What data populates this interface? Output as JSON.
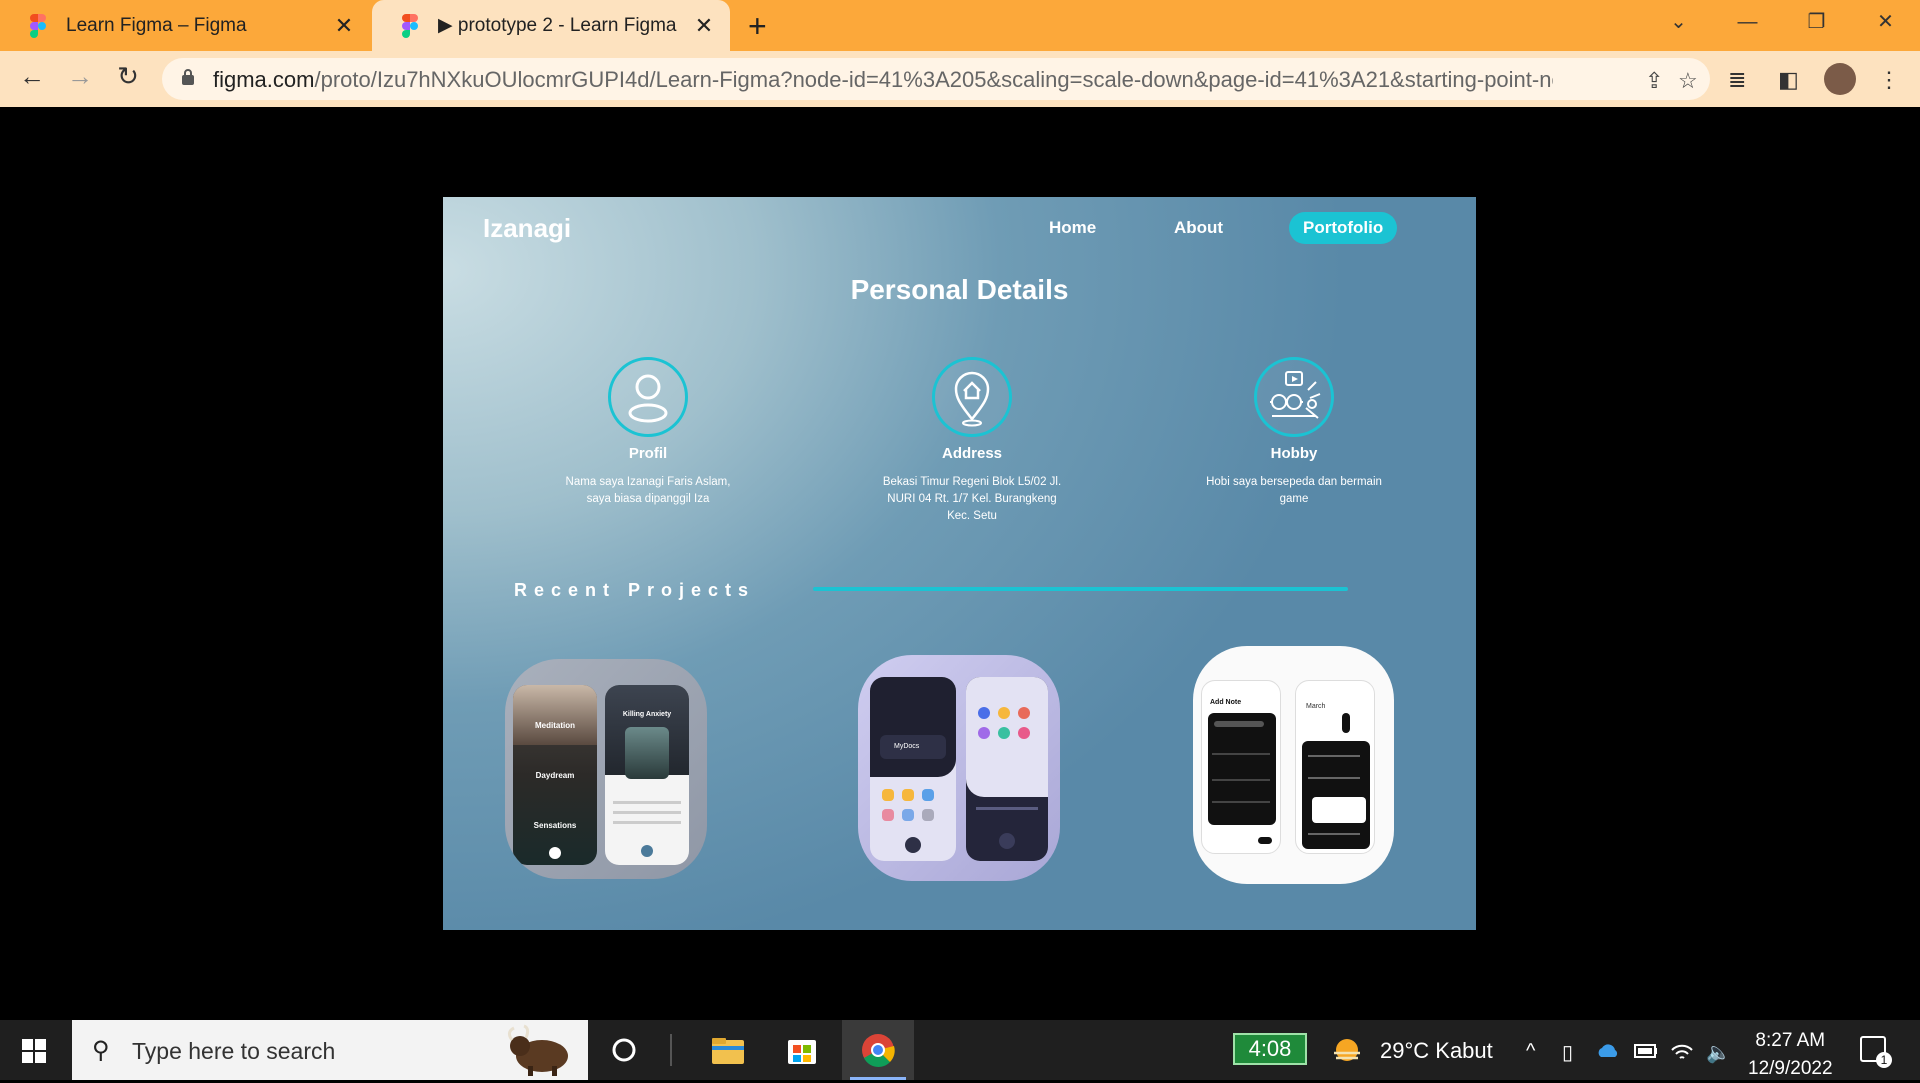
{
  "browser": {
    "tabs": [
      {
        "title": "Learn Figma – Figma",
        "active": false
      },
      {
        "title": "▶ prototype 2 - Learn Figma",
        "active": true
      }
    ],
    "new_tab": "+",
    "window_controls": {
      "collapse": "⌄",
      "minimize": "—",
      "restore": "❐",
      "close": "✕"
    },
    "url_host": "figma.com",
    "url_path": "/proto/Izu7hNXkuOUlocmrGUPI4d/Learn-Figma?node-id=41%3A205&scaling=scale-down&page-id=41%3A21&starting-point-node-id=...",
    "accent_color": "#fca83a"
  },
  "site": {
    "logo": "Izanagi",
    "nav": [
      {
        "label": "Home",
        "active": false
      },
      {
        "label": "About",
        "active": false
      },
      {
        "label": "Portofolio",
        "active": true
      }
    ],
    "page_title": "Personal Details",
    "details": [
      {
        "label": "Profil",
        "icon": "user-icon",
        "text": "Nama saya Izanagi Faris Aslam, saya biasa dipanggil Iza"
      },
      {
        "label": "Address",
        "icon": "map-pin-home-icon",
        "text": "Bekasi Timur Regeni Blok L5/02 Jl. NURI 04 Rt. 1/7 Kel. Burangkeng Kec. Setu"
      },
      {
        "label": "Hobby",
        "icon": "hobby-icon",
        "text": "Hobi saya bersepeda dan bermain game"
      }
    ],
    "recent_projects": "Recent Projects",
    "projects": [
      {
        "name": "meditation-app-mockup",
        "screens": [
          "Meditation",
          "Daydream",
          "Sensations",
          "Killing Anxiety"
        ]
      },
      {
        "name": "mydocs-app-mockup",
        "screens": [
          "MyDocs"
        ]
      },
      {
        "name": "notes-calendar-app-mockup",
        "screens": [
          "Add Note",
          "March"
        ]
      }
    ],
    "accent_color": "#1bc3d3"
  },
  "taskbar": {
    "search_placeholder": "Type here to search",
    "battery_time": "4:08",
    "weather": "29°C  Kabut",
    "time": "8:27 AM",
    "date": "12/9/2022",
    "notification_count": "1"
  }
}
